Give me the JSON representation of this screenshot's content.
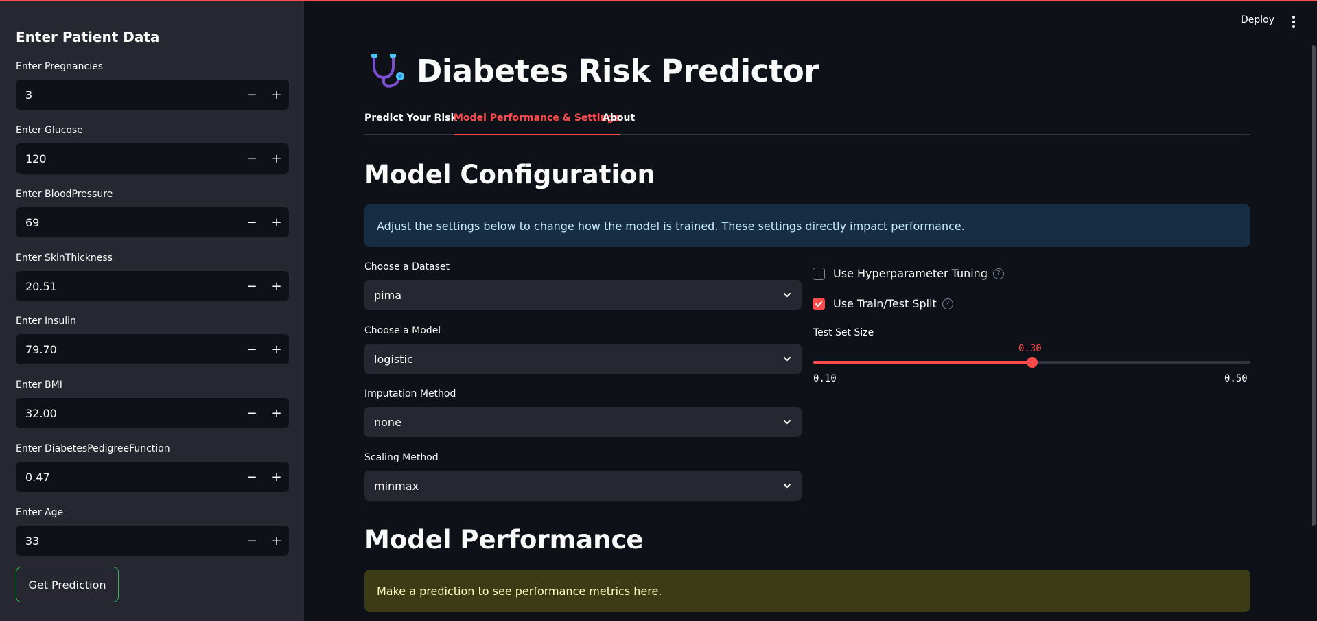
{
  "sidebar": {
    "title": "Enter Patient Data",
    "fields": [
      {
        "label": "Enter Pregnancies",
        "value": "3"
      },
      {
        "label": "Enter Glucose",
        "value": "120"
      },
      {
        "label": "Enter BloodPressure",
        "value": "69"
      },
      {
        "label": "Enter SkinThickness",
        "value": "20.51"
      },
      {
        "label": "Enter Insulin",
        "value": "79.70"
      },
      {
        "label": "Enter BMI",
        "value": "32.00"
      },
      {
        "label": "Enter DiabetesPedigreeFunction",
        "value": "0.47"
      },
      {
        "label": "Enter Age",
        "value": "33"
      }
    ],
    "stepper_minus": "−",
    "stepper_plus": "+",
    "button_label": "Get Prediction"
  },
  "header": {
    "deploy_label": "Deploy",
    "app_title": "Diabetes Risk Predictor",
    "logo_icon": "stethoscope-icon"
  },
  "tabs": [
    {
      "label": "Predict Your Risk",
      "active": false
    },
    {
      "label": "Model Performance & Settings",
      "active": true
    },
    {
      "label": "About",
      "active": false
    }
  ],
  "config": {
    "heading": "Model Configuration",
    "info_text": "Adjust the settings below to change how the model is trained. These settings directly impact performance.",
    "selects": [
      {
        "label": "Choose a Dataset",
        "value": "pima"
      },
      {
        "label": "Choose a Model",
        "value": "logistic"
      },
      {
        "label": "Imputation Method",
        "value": "none"
      },
      {
        "label": "Scaling Method",
        "value": "minmax"
      }
    ],
    "checkboxes": [
      {
        "label": "Use Hyperparameter Tuning",
        "checked": false
      },
      {
        "label": "Use Train/Test Split",
        "checked": true
      }
    ],
    "slider": {
      "label": "Test Set Size",
      "value": "0.30",
      "min": "0.10",
      "max": "0.50",
      "fraction": 0.5
    }
  },
  "performance": {
    "heading": "Model Performance",
    "warning_text": "Make a prediction to see performance metrics here."
  },
  "colors": {
    "accent": "#ff4b4b",
    "background": "#0e1117",
    "sidebar": "#262730",
    "info_bg": "#172d43",
    "warning_bg": "#3d3a16",
    "button_border": "#21c354"
  }
}
